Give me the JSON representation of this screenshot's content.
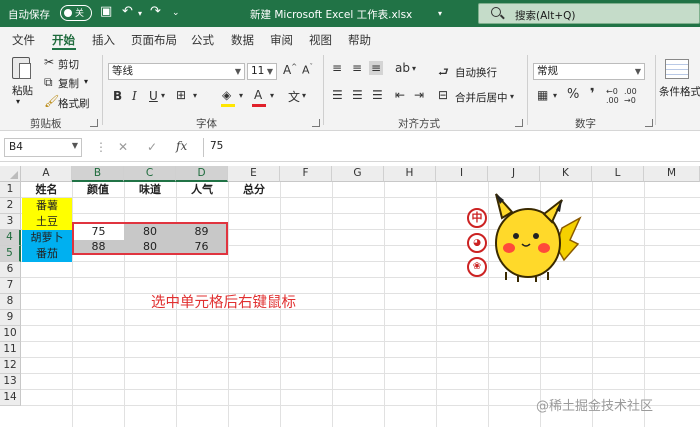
{
  "titlebar": {
    "autosave_label": "自动保存",
    "autosave_state": "关",
    "doc_title": "新建 Microsoft Excel 工作表.xlsx",
    "search_placeholder": "搜索(Alt+Q)",
    "colors": {
      "brand": "#217346"
    }
  },
  "menu": {
    "tabs": [
      "文件",
      "开始",
      "插入",
      "页面布局",
      "公式",
      "数据",
      "审阅",
      "视图",
      "帮助"
    ],
    "active": "开始"
  },
  "ribbon": {
    "clipboard": {
      "paste": "粘贴",
      "cut": "剪切",
      "copy": "复制",
      "format_painter": "格式刷",
      "group": "剪贴板"
    },
    "font": {
      "font_name": "等线",
      "font_size": "11",
      "group": "字体"
    },
    "alignment": {
      "wrap": "自动换行",
      "merge": "合并后居中",
      "group": "对齐方式"
    },
    "number": {
      "format": "常规",
      "group": "数字"
    },
    "styles": {
      "conditional": "条件格式"
    }
  },
  "formula_bar": {
    "name_box": "B4",
    "fx": "fx",
    "value": "75"
  },
  "sheet": {
    "columns": [
      "A",
      "B",
      "C",
      "D",
      "E",
      "F",
      "G",
      "H",
      "I",
      "J",
      "K",
      "L",
      "M"
    ],
    "rows": [
      "1",
      "2",
      "3",
      "4",
      "5",
      "6",
      "7",
      "8",
      "9",
      "10",
      "11",
      "12",
      "13",
      "14"
    ],
    "cells": {
      "A1": "姓名",
      "B1": "颜值",
      "C1": "味道",
      "D1": "人气",
      "E1": "总分",
      "A2": "番薯",
      "A3": "土豆",
      "A4": "胡萝卜",
      "A5": "番茄",
      "B4": "75",
      "C4": "80",
      "D4": "89",
      "B5": "88",
      "C5": "80",
      "D5": "76"
    },
    "colors": {
      "yellow_fill": "#ffff00",
      "blue_fill": "#00b0f0",
      "gray_fill": "#c8c8c8",
      "selection": "#e0343f"
    }
  },
  "annotation": "选中单元格后右键鼠标",
  "sticker": {
    "badge_1": "中"
  },
  "watermark": "@稀土掘金技术社区"
}
